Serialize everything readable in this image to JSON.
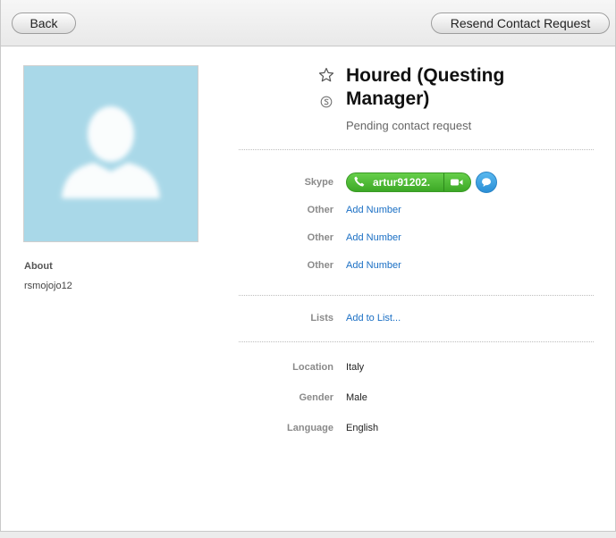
{
  "toolbar": {
    "back_label": "Back",
    "resend_label": "Resend Contact Request"
  },
  "profile": {
    "name": "Houred (Questing Manager)",
    "status": "Pending contact request",
    "about_heading": "About",
    "about_value": "rsmojojo12"
  },
  "contact": {
    "skype_label": "Skype",
    "skype_value": "artur91202.",
    "others": [
      {
        "label": "Other",
        "value": "Add Number"
      },
      {
        "label": "Other",
        "value": "Add Number"
      },
      {
        "label": "Other",
        "value": "Add Number"
      }
    ],
    "lists_label": "Lists",
    "lists_value": "Add to List..."
  },
  "details": [
    {
      "label": "Location",
      "value": "Italy"
    },
    {
      "label": "Gender",
      "value": "Male"
    },
    {
      "label": "Language",
      "value": "English"
    }
  ],
  "colors": {
    "call_green": "#4cb832",
    "link_blue": "#1a6fc4",
    "avatar_bg": "#a9d8e8"
  },
  "icons": [
    "star-icon",
    "skype-icon",
    "phone-icon",
    "video-icon",
    "chat-icon",
    "avatar-silhouette-icon"
  ]
}
